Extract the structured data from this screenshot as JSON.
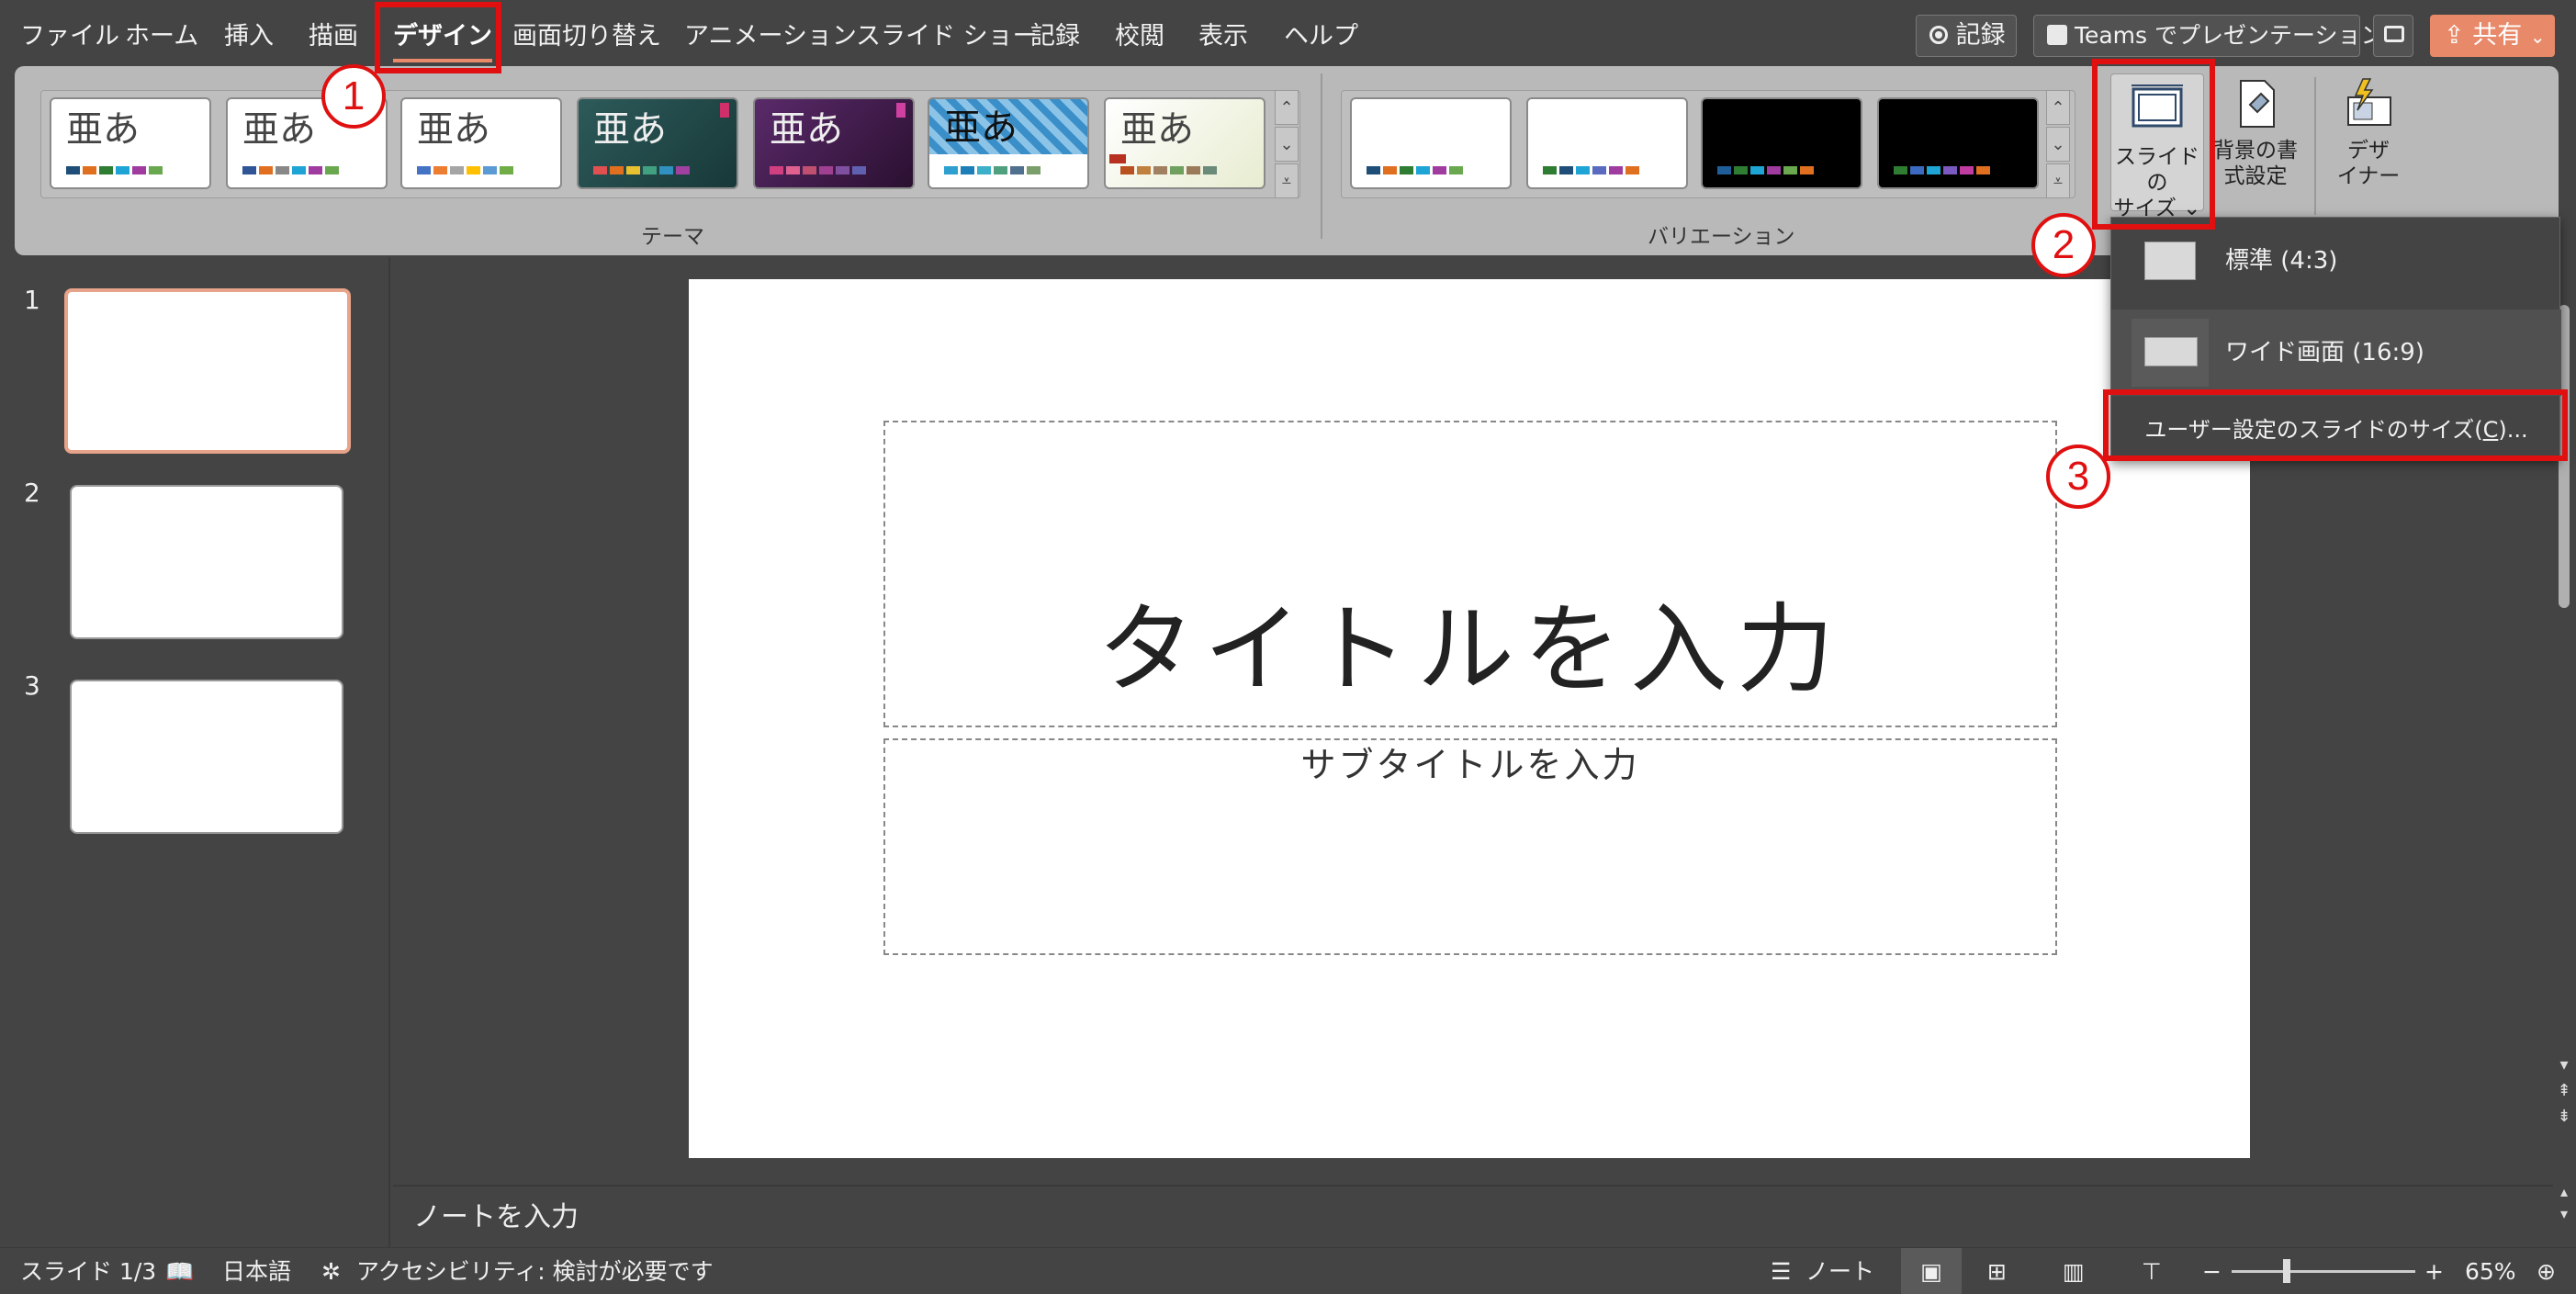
{
  "menu": {
    "items": [
      "ファイル",
      "ホーム",
      "挿入",
      "描画",
      "デザイン",
      "画面切り替え",
      "アニメーション",
      "スライド ショー",
      "記録",
      "校閲",
      "表示",
      "ヘルプ"
    ],
    "active": "デザイン"
  },
  "topbar": {
    "record_label": "記録",
    "teams_label": "Teams でプレゼンテーション",
    "share_label": "共有"
  },
  "ribbon": {
    "theme_sample": "亜あ",
    "themes_group_label": "テーマ",
    "variations_group_label": "バリエーション",
    "slide_size_label_1": "スライドの",
    "slide_size_label_2": "サイズ ⌄",
    "bg_format_label_1": "背景の書",
    "bg_format_label_2": "式設定",
    "designer_label_1": "デザ",
    "designer_label_2": "イナー"
  },
  "dropdown": {
    "standard_label": "標準 (4:3)",
    "wide_label": "ワイド画面 (16:9)",
    "custom_label_prefix": "ユーザー設定のスライドのサイズ(",
    "custom_label_key": "C",
    "custom_label_suffix": ")..."
  },
  "annotations": {
    "step1": "1",
    "step2": "2",
    "step3": "3"
  },
  "slides": {
    "numbers": [
      "1",
      "2",
      "3"
    ]
  },
  "slide": {
    "title_placeholder": "タイトルを入力",
    "subtitle_placeholder": "サブタイトルを入力"
  },
  "notes": {
    "placeholder": "ノートを入力"
  },
  "statusbar": {
    "slide_indicator": "スライド 1/3",
    "language": "日本語",
    "accessibility": "アクセシビリティ: 検討が必要です",
    "notes_label": "ノート",
    "zoom": "65%"
  },
  "colors": {
    "accent": "#e8896a",
    "annotation_red": "#e01010"
  }
}
